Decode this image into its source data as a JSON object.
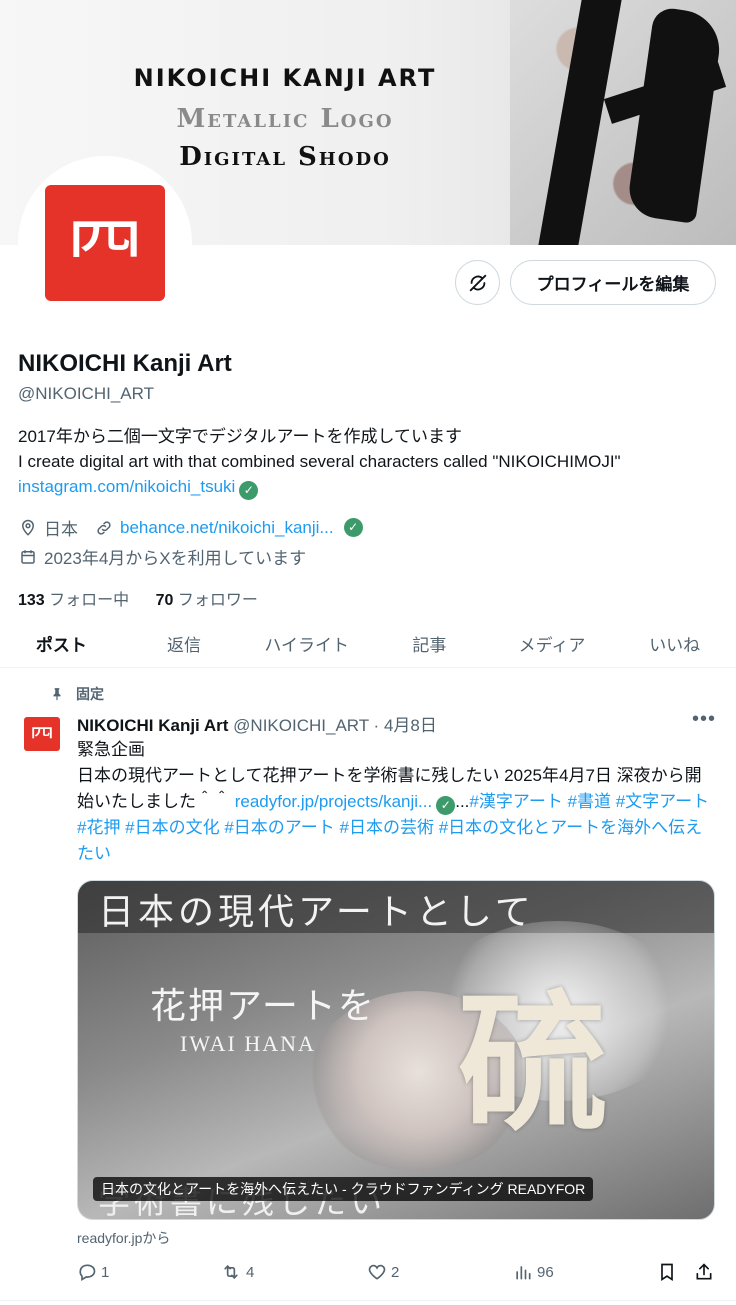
{
  "banner": {
    "line1": "NIKOICHI KANJI ART",
    "line2": "Metallic Logo",
    "line3": "Digital Shodo"
  },
  "avatar": {
    "glyph": "𦉪"
  },
  "profile": {
    "edit_label": "プロフィールを編集",
    "name": "NIKOICHI Kanji Art",
    "handle": "@NIKOICHI_ART",
    "bio_line1": "2017年から二個一文字でデジタルアートを作成しています",
    "bio_line2": "I create digital art with that combined several characters called \"NIKOICHIMOJI\"",
    "bio_link": "instagram.com/nikoichi_tsuki",
    "location": "日本",
    "website": "behance.net/nikoichi_kanji...",
    "joined": "2023年4月からXを利用しています",
    "following_count": "133",
    "following_label": "フォロー中",
    "followers_count": "70",
    "followers_label": "フォロワー"
  },
  "tabs": [
    {
      "label": "ポスト"
    },
    {
      "label": "返信"
    },
    {
      "label": "ハイライト"
    },
    {
      "label": "記事"
    },
    {
      "label": "メディア"
    },
    {
      "label": "いいね"
    }
  ],
  "post": {
    "pinned_label": "固定",
    "author": "NIKOICHI Kanji Art",
    "handle_date": "@NIKOICHI_ART · 4月8日",
    "line1": "緊急企画",
    "line2": "日本の現代アートとして花押アートを学術書に残したい 2025年4月7日 深夜から開始いたしました＾＾",
    "link": "readyfor.jp/projects/kanji...",
    "ellipsis": "...",
    "hashtags": "#漢字アート #書道 #文字アート #花押 #日本の文化 #日本のアート #日本の芸術 #日本の文化とアートを海外へ伝えたい",
    "media": {
      "heading": "日本の現代アートとして",
      "subheading": "花押アートを",
      "name": "IWAI HANA",
      "calligraphy": "硫",
      "bottom": "学術書に残したい",
      "caption": "日本の文化とアートを海外へ伝えたい - クラウドファンディング READYFOR"
    },
    "source": "readyfor.jpから",
    "replies": "1",
    "reposts": "4",
    "likes": "2",
    "views": "96"
  },
  "colors": {
    "link": "#1d9bf0",
    "seal": "#e5332a",
    "verified": "#3d9b6b",
    "muted": "#536471"
  }
}
